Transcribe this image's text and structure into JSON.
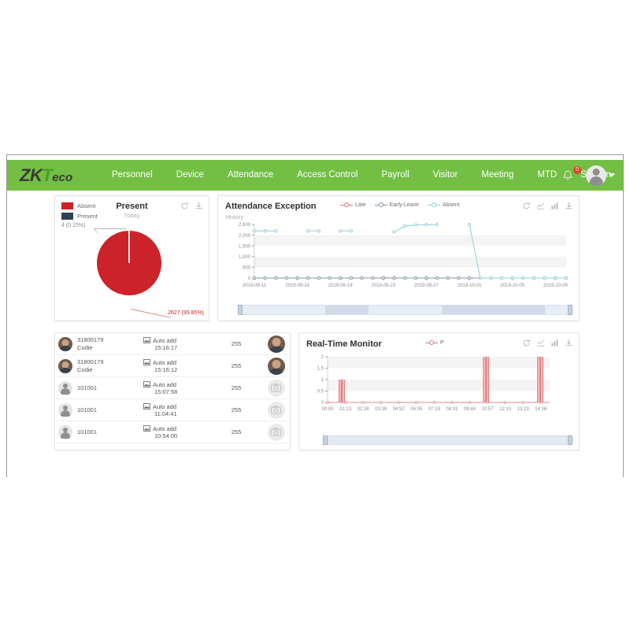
{
  "app": {
    "logo": {
      "zk": "ZK",
      "t": "T",
      "eco": "eco"
    },
    "nav_items": [
      {
        "label": "Personnel"
      },
      {
        "label": "Device"
      },
      {
        "label": "Attendance"
      },
      {
        "label": "Access Control"
      },
      {
        "label": "Payroll"
      },
      {
        "label": "Visitor"
      },
      {
        "label": "Meeting"
      },
      {
        "label": "MTD"
      },
      {
        "label": "System"
      }
    ],
    "notification_count": "0",
    "accent_green": "#72bf44"
  },
  "present_card": {
    "title": "Present",
    "subtitle": "Today",
    "legend": [
      {
        "label": "Absent",
        "color": "#cc2229"
      },
      {
        "label": "Present",
        "color": "#2b4358"
      }
    ],
    "label_minor": "4 (0.15%)",
    "label_major": "2627 (99.85%)",
    "toolbar": [
      {
        "icon": "refresh-icon"
      },
      {
        "icon": "download-icon"
      }
    ],
    "chart_data": {
      "type": "pie",
      "title": "Present",
      "labels": [
        "Present",
        "Absent"
      ],
      "values": [
        4,
        2627
      ],
      "percentages": [
        0.15,
        99.85
      ],
      "colors": [
        "#2b4358",
        "#cc2229"
      ]
    }
  },
  "exception_card": {
    "title": "Attendance Exception",
    "subtitle": "History",
    "legend": [
      {
        "label": "Late",
        "color": "#e8737c"
      },
      {
        "label": "Early-Leave",
        "color": "#8495a8"
      },
      {
        "label": "Absent",
        "color": "#8fcfd6"
      }
    ],
    "toolbar": [
      {
        "icon": "refresh-icon"
      },
      {
        "icon": "line-chart-icon"
      },
      {
        "icon": "bar-chart-icon"
      },
      {
        "icon": "download-icon"
      }
    ],
    "chart_data": {
      "type": "line",
      "title": "Attendance Exception",
      "subtitle": "History",
      "xlabel": "",
      "ylabel": "",
      "ylim": [
        0,
        2500
      ],
      "yticks": [
        0,
        500,
        1000,
        1500,
        2000,
        2500
      ],
      "ytick_labels": [
        "0",
        "500",
        "1,000",
        "1,500",
        "2,000",
        "2,500"
      ],
      "xtick_labels": [
        "2019-09-11",
        "2019-09-15",
        "2019-09-19",
        "2019-09-23",
        "2019-09-27",
        "2019-10-01",
        "2019-10-05",
        "2019-10-09"
      ],
      "x": [
        "2019-09-11",
        "2019-09-12",
        "2019-09-13",
        "2019-09-14",
        "2019-09-15",
        "2019-09-16",
        "2019-09-17",
        "2019-09-18",
        "2019-09-19",
        "2019-09-20",
        "2019-09-21",
        "2019-09-22",
        "2019-09-23",
        "2019-09-24",
        "2019-09-25",
        "2019-09-26",
        "2019-09-27",
        "2019-09-28",
        "2019-09-29",
        "2019-09-30",
        "2019-10-01",
        "2019-10-02",
        "2019-10-03",
        "2019-10-04",
        "2019-10-05",
        "2019-10-06",
        "2019-10-07",
        "2019-10-08",
        "2019-10-09",
        "2019-10-10"
      ],
      "series": [
        {
          "name": "Late",
          "color": "#e8737c",
          "values": [
            0,
            0,
            0,
            0,
            0,
            0,
            0,
            0,
            0,
            0,
            0,
            0,
            3,
            2,
            0,
            0,
            0,
            0,
            0,
            0,
            0,
            0,
            0,
            0,
            0,
            0,
            0,
            0,
            0,
            0
          ]
        },
        {
          "name": "Early-Leave",
          "color": "#8495a8",
          "values": [
            0,
            0,
            0,
            0,
            0,
            0,
            0,
            0,
            0,
            0,
            0,
            0,
            0,
            0,
            0,
            0,
            0,
            0,
            0,
            0,
            0,
            0,
            0,
            0,
            0,
            0,
            0,
            0,
            0,
            0
          ]
        },
        {
          "name": "Absent",
          "color": "#8fcfd6",
          "values": [
            2200,
            2200,
            2200,
            null,
            null,
            2200,
            2200,
            null,
            2200,
            2200,
            null,
            null,
            null,
            2150,
            2430,
            2480,
            2490,
            2490,
            null,
            null,
            2500,
            0,
            0,
            0,
            0,
            0,
            0,
            0,
            0,
            0
          ]
        }
      ],
      "grid": true,
      "legend_position": "top-center",
      "has_data_zoom_slider": true
    }
  },
  "list_card": {
    "rows": [
      {
        "id": "31800179",
        "name": "Codie",
        "event": "Auto add",
        "time": "15:16:17",
        "code": "255",
        "has_photo": true
      },
      {
        "id": "31800179",
        "name": "Codie",
        "event": "Auto add",
        "time": "15:16:12",
        "code": "255",
        "has_photo": true
      },
      {
        "id": "101001",
        "name": "",
        "event": "Auto add",
        "time": "15:07:58",
        "code": "255",
        "has_photo": false
      },
      {
        "id": "101001",
        "name": "",
        "event": "Auto add",
        "time": "11:04:41",
        "code": "255",
        "has_photo": false
      },
      {
        "id": "101001",
        "name": "",
        "event": "Auto add",
        "time": "10:54:00",
        "code": "255",
        "has_photo": false
      }
    ]
  },
  "monitor_card": {
    "title": "Real-Time Monitor",
    "legend": [
      {
        "label": "P",
        "color": "#e8737c"
      }
    ],
    "toolbar": [
      {
        "icon": "refresh-icon"
      },
      {
        "icon": "line-chart-icon"
      },
      {
        "icon": "bar-chart-icon"
      },
      {
        "icon": "download-icon"
      }
    ],
    "chart_data": {
      "type": "bar",
      "title": "Real-Time Monitor",
      "xlabel": "",
      "ylabel": "",
      "ylim": [
        0,
        2
      ],
      "yticks": [
        0,
        0.5,
        1,
        1.5,
        2
      ],
      "ytick_labels": [
        "0",
        "0.5",
        "1",
        "1.5",
        "2"
      ],
      "xtick_labels": [
        "00:00",
        "01:13",
        "02:26",
        "03:39",
        "04:52",
        "06:05",
        "07:18",
        "08:31",
        "09:44",
        "10:57",
        "12:10",
        "13:23",
        "14:36"
      ],
      "series_name": "P",
      "bars": [
        {
          "x": "00:52",
          "value": 1
        },
        {
          "x": "01:05",
          "value": 1
        },
        {
          "x": "10:45",
          "value": 2
        },
        {
          "x": "10:57",
          "value": 2
        },
        {
          "x": "14:28",
          "value": 2
        },
        {
          "x": "14:40",
          "value": 2
        }
      ],
      "grid": true,
      "legend_position": "top-center",
      "has_data_zoom_slider": true
    }
  }
}
